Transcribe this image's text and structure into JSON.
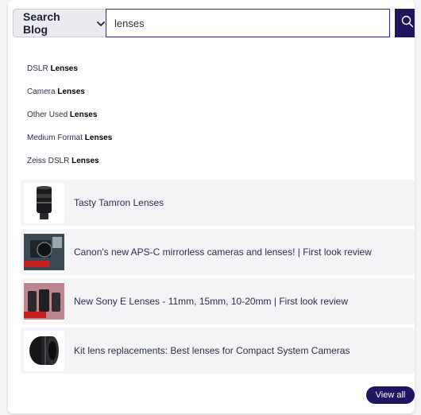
{
  "search": {
    "scope_label": "Search Blog",
    "query": "lenses",
    "button_icon": "search-icon"
  },
  "suggestions": [
    {
      "prefix": "DSLR",
      "match": "Lenses"
    },
    {
      "prefix": "Camera",
      "match": "Lenses"
    },
    {
      "prefix": "Other Used",
      "match": "Lenses"
    },
    {
      "prefix": "Medium Format",
      "match": "Lenses"
    },
    {
      "prefix": "Zeiss DSLR",
      "match": "Lenses"
    }
  ],
  "results": [
    {
      "title": "Tasty Tamron Lenses",
      "thumb": "lens-thumbnail"
    },
    {
      "title": "Canon's new APS-C mirrorless cameras and lenses! | First look review",
      "thumb": "camera-review-thumbnail"
    },
    {
      "title": "New Sony E Lenses - 11mm, 15mm, 10-20mm | First look review",
      "thumb": "lenses-review-thumbnail"
    },
    {
      "title": "Kit lens replacements: Best lenses for Compact System Cameras",
      "thumb": "lens-thumbnail"
    }
  ],
  "view_all_label": "View all",
  "colors": {
    "accent": "#1e1760",
    "scope_bg": "#e9ebf0",
    "result_bg": "#f4f4f6"
  }
}
